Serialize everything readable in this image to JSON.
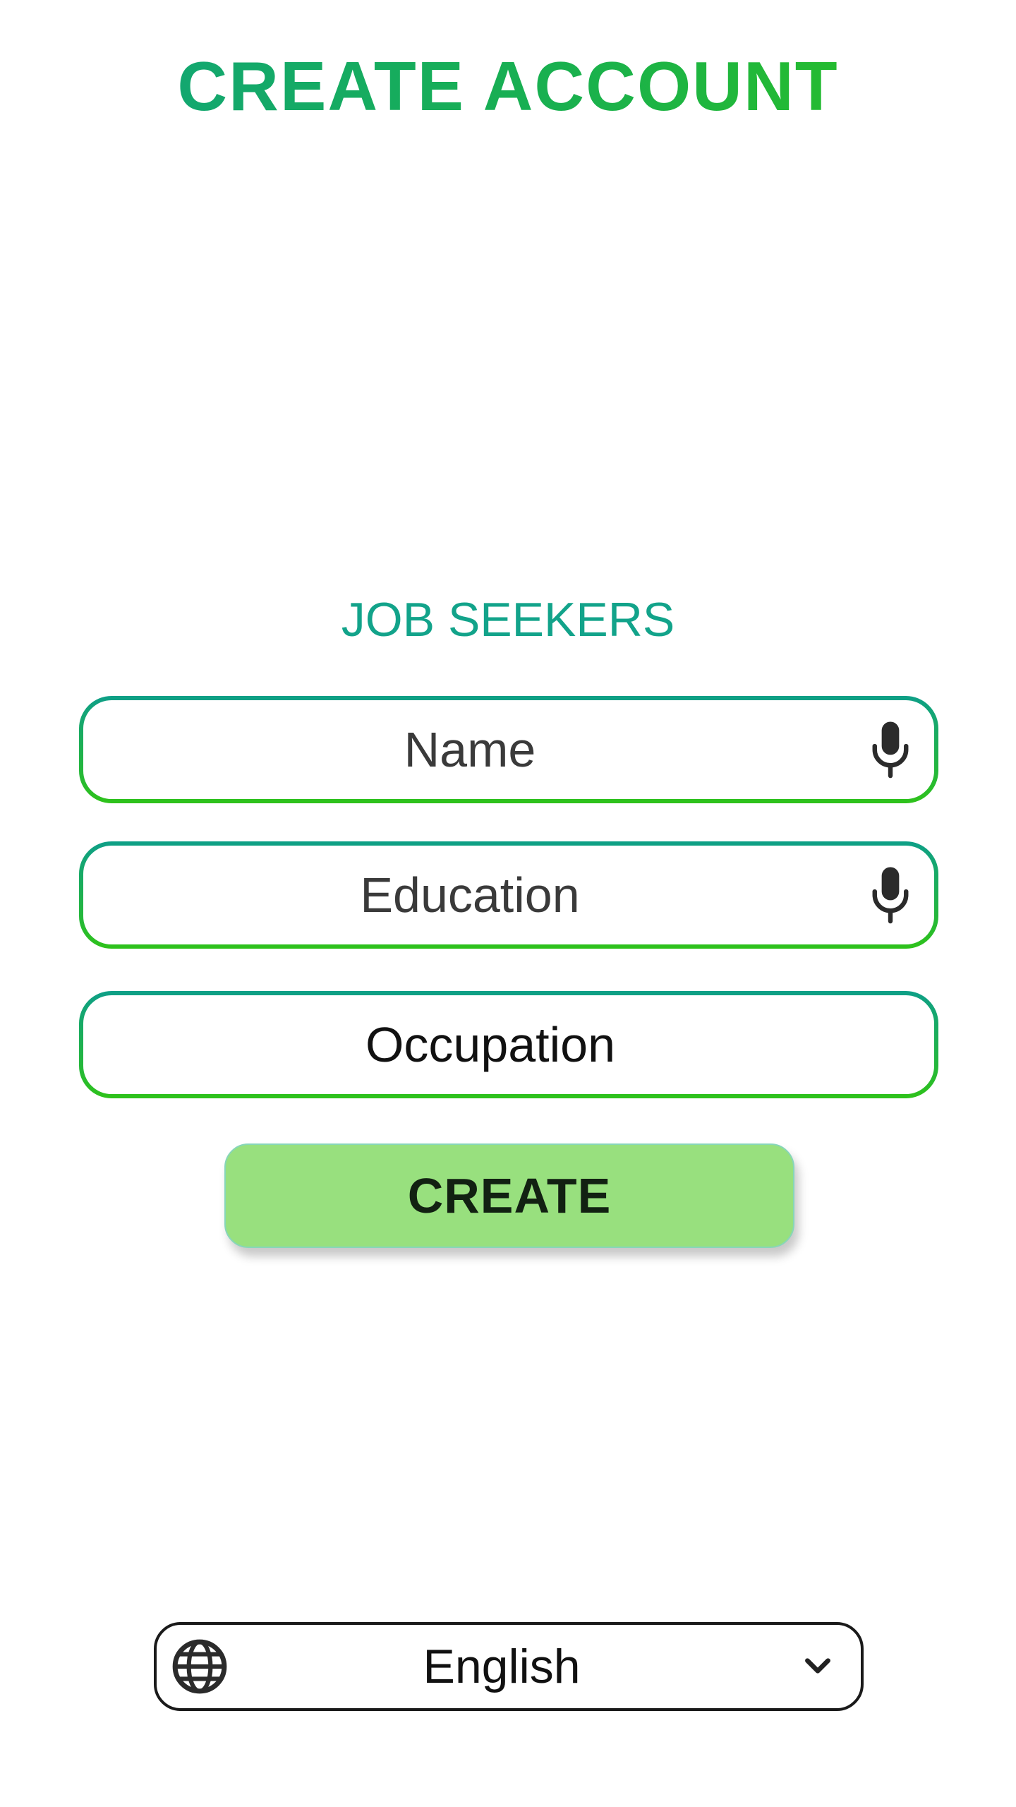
{
  "header": {
    "title": "CREATE ACCOUNT"
  },
  "form": {
    "section_label": "JOB SEEKERS",
    "name_field": {
      "placeholder": "Name",
      "value": "",
      "icon": "microphone-icon"
    },
    "education_field": {
      "placeholder": "Education",
      "value": "",
      "icon": "microphone-icon"
    },
    "occupation_field": {
      "label": "Occupation"
    },
    "submit_label": "CREATE"
  },
  "language_selector": {
    "selected": "English",
    "icon": "globe-icon",
    "dropdown_icon": "chevron-down-icon"
  },
  "colors": {
    "accent_teal": "#10a37f",
    "accent_green": "#2cc21c",
    "button_fill": "#98e07e",
    "text_dark": "#111111"
  }
}
